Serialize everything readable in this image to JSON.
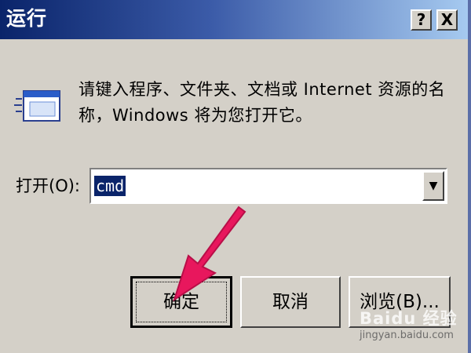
{
  "window": {
    "title": "运行",
    "help_button": "?",
    "close_button": "X"
  },
  "prompt": {
    "line1": "请键入程序、文件夹、文档或 Internet 资源的名",
    "line2": "称，Windows 将为您打开它。"
  },
  "open_field": {
    "label": "打开(O):",
    "value": "cmd",
    "dropdown_glyph": "▼"
  },
  "buttons": {
    "ok": "确定",
    "cancel": "取消",
    "browse": "浏览(B)..."
  },
  "watermark": {
    "logo": "Baidu 经验",
    "url": "jingyan.baidu.com"
  },
  "colors": {
    "titlebar_start": "#0a246a",
    "titlebar_end": "#a6caf0",
    "dialog_bg": "#d4d0c8",
    "selection": "#0a246a",
    "arrow": "#e8175d"
  },
  "icons": {
    "dialog_icon": "run-window-icon",
    "annotation": "pink-pointer-arrow-icon"
  }
}
